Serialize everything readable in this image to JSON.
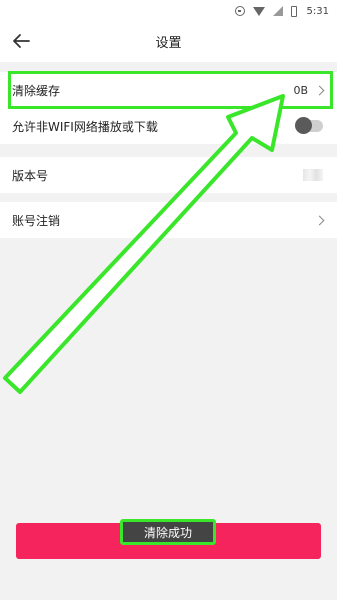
{
  "status_bar": {
    "time": "5:31"
  },
  "header": {
    "title": "设置"
  },
  "settings": {
    "clear_cache_label": "清除缓存",
    "cache_size": "0B",
    "wifi_label": "允许非WIFI网络播放或下载",
    "wifi_enabled": false,
    "version_label": "版本号",
    "account_cancel_label": "账号注销"
  },
  "toast": {
    "text": "清除成功"
  },
  "colors": {
    "primary": "#f5245d",
    "highlight": "#39e62a"
  },
  "icons": [
    "back-arrow-icon",
    "chevron-right-icon",
    "wifi-icon",
    "signal-icon",
    "battery-icon"
  ]
}
